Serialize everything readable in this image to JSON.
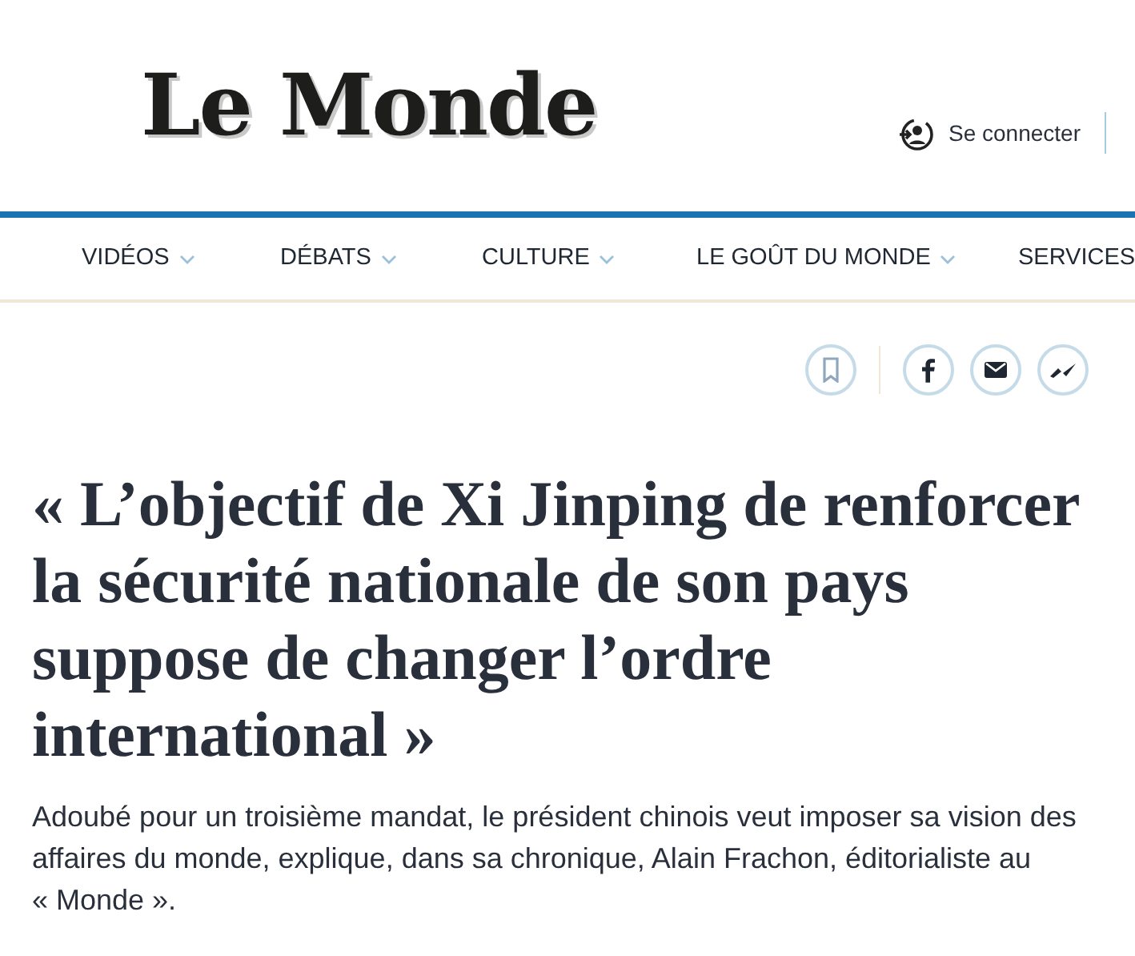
{
  "logo": "Le Monde",
  "login": {
    "label": "Se connecter"
  },
  "nav": [
    {
      "label": "VIDÉOS",
      "has_menu": true
    },
    {
      "label": "DÉBATS",
      "has_menu": true
    },
    {
      "label": "CULTURE",
      "has_menu": true
    },
    {
      "label": "LE GOÛT DU MONDE",
      "has_menu": true
    },
    {
      "label": "SERVICES"
    }
  ],
  "share": [
    {
      "kind": "bookmark"
    },
    {
      "kind": "facebook"
    },
    {
      "kind": "email"
    },
    {
      "kind": "messenger"
    }
  ],
  "headline": "« L’objectif de Xi Jinping de renforcer la sécurité nationale de son pays suppose de changer l’ordre international »",
  "standfirst": "Adoubé pour un troisième mandat, le président chinois veut imposer sa vision des affaires du monde, explique, dans sa chronique, Alain Frachon, éditorialiste au « Monde »."
}
